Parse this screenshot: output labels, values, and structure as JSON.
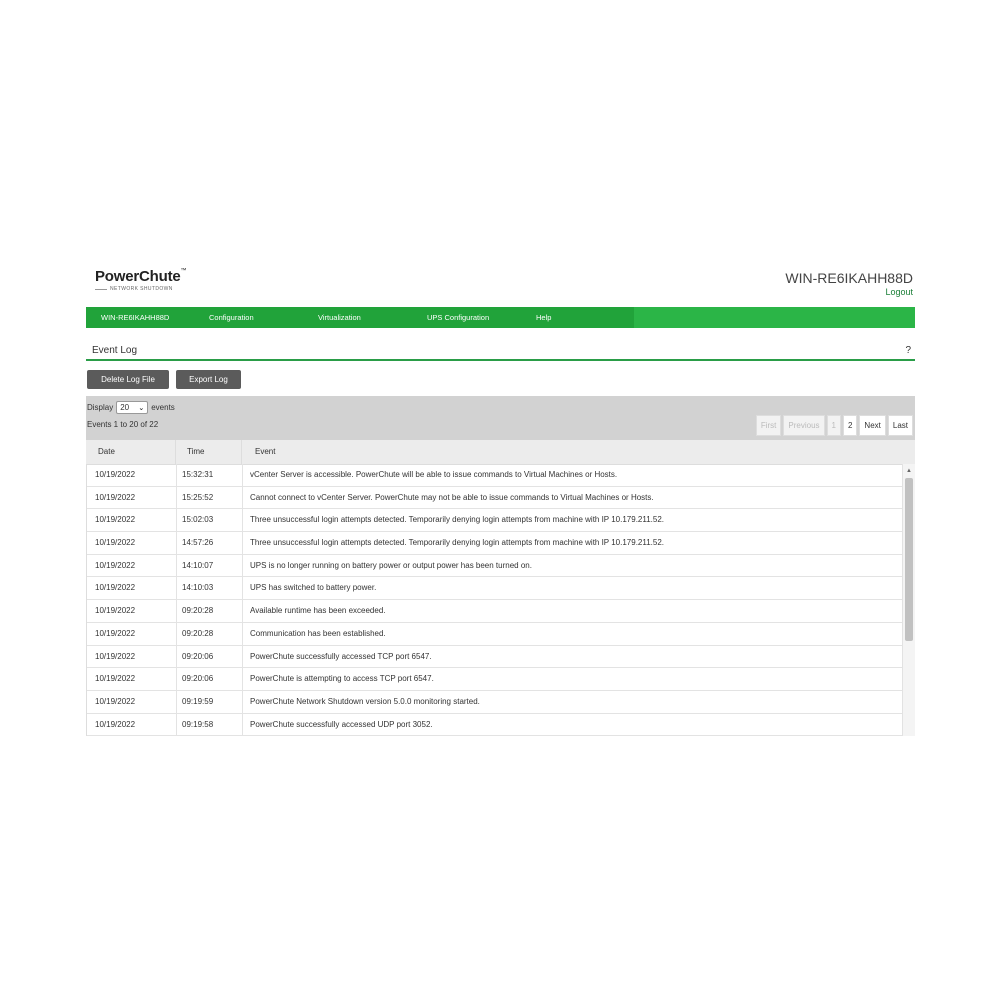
{
  "brand": {
    "name": "PowerChute",
    "mark": "™",
    "subtitle": "NETWORK SHUTDOWN"
  },
  "header": {
    "host": "WIN-RE6IKAHH88D",
    "logout": "Logout"
  },
  "nav": {
    "items": [
      {
        "label": "WIN-RE6IKAHH88D"
      },
      {
        "label": "Configuration"
      },
      {
        "label": "Virtualization"
      },
      {
        "label": "UPS Configuration"
      },
      {
        "label": "Help"
      }
    ]
  },
  "page": {
    "title": "Event Log",
    "help": "?"
  },
  "buttons": {
    "delete": "Delete Log File",
    "export": "Export Log"
  },
  "display": {
    "prefix": "Display",
    "selected": "20",
    "suffix": "events"
  },
  "summary": "Events 1 to 20 of 22",
  "pagination": {
    "first": "First",
    "previous": "Previous",
    "page1": "1",
    "page2": "2",
    "next": "Next",
    "last": "Last"
  },
  "table": {
    "headers": {
      "date": "Date",
      "time": "Time",
      "event": "Event"
    },
    "rows": [
      {
        "date": "10/19/2022",
        "time": "15:32:31",
        "event": "vCenter Server is accessible. PowerChute will be able to issue commands to Virtual Machines or Hosts."
      },
      {
        "date": "10/19/2022",
        "time": "15:25:52",
        "event": "Cannot connect to vCenter Server. PowerChute may not be able to issue commands to Virtual Machines or Hosts."
      },
      {
        "date": "10/19/2022",
        "time": "15:02:03",
        "event": "Three unsuccessful login attempts detected. Temporarily denying login attempts from machine with IP 10.179.211.52."
      },
      {
        "date": "10/19/2022",
        "time": "14:57:26",
        "event": "Three unsuccessful login attempts detected. Temporarily denying login attempts from machine with IP 10.179.211.52."
      },
      {
        "date": "10/19/2022",
        "time": "14:10:07",
        "event": "UPS is no longer running on battery power or output power has been turned on."
      },
      {
        "date": "10/19/2022",
        "time": "14:10:03",
        "event": "UPS has switched to battery power."
      },
      {
        "date": "10/19/2022",
        "time": "09:20:28",
        "event": "Available runtime has been exceeded."
      },
      {
        "date": "10/19/2022",
        "time": "09:20:28",
        "event": "Communication has been established."
      },
      {
        "date": "10/19/2022",
        "time": "09:20:06",
        "event": "PowerChute successfully accessed TCP port 6547."
      },
      {
        "date": "10/19/2022",
        "time": "09:20:06",
        "event": "PowerChute is attempting to access TCP port 6547."
      },
      {
        "date": "10/19/2022",
        "time": "09:19:59",
        "event": "PowerChute Network Shutdown version 5.0.0 monitoring started."
      },
      {
        "date": "10/19/2022",
        "time": "09:19:58",
        "event": "PowerChute successfully accessed UDP port 3052."
      }
    ]
  },
  "colors": {
    "nav_green": "#21a33a",
    "accent_green": "#2a9d48",
    "button_gray": "#5b5b5b",
    "panel_gray": "#d2d2d2"
  }
}
